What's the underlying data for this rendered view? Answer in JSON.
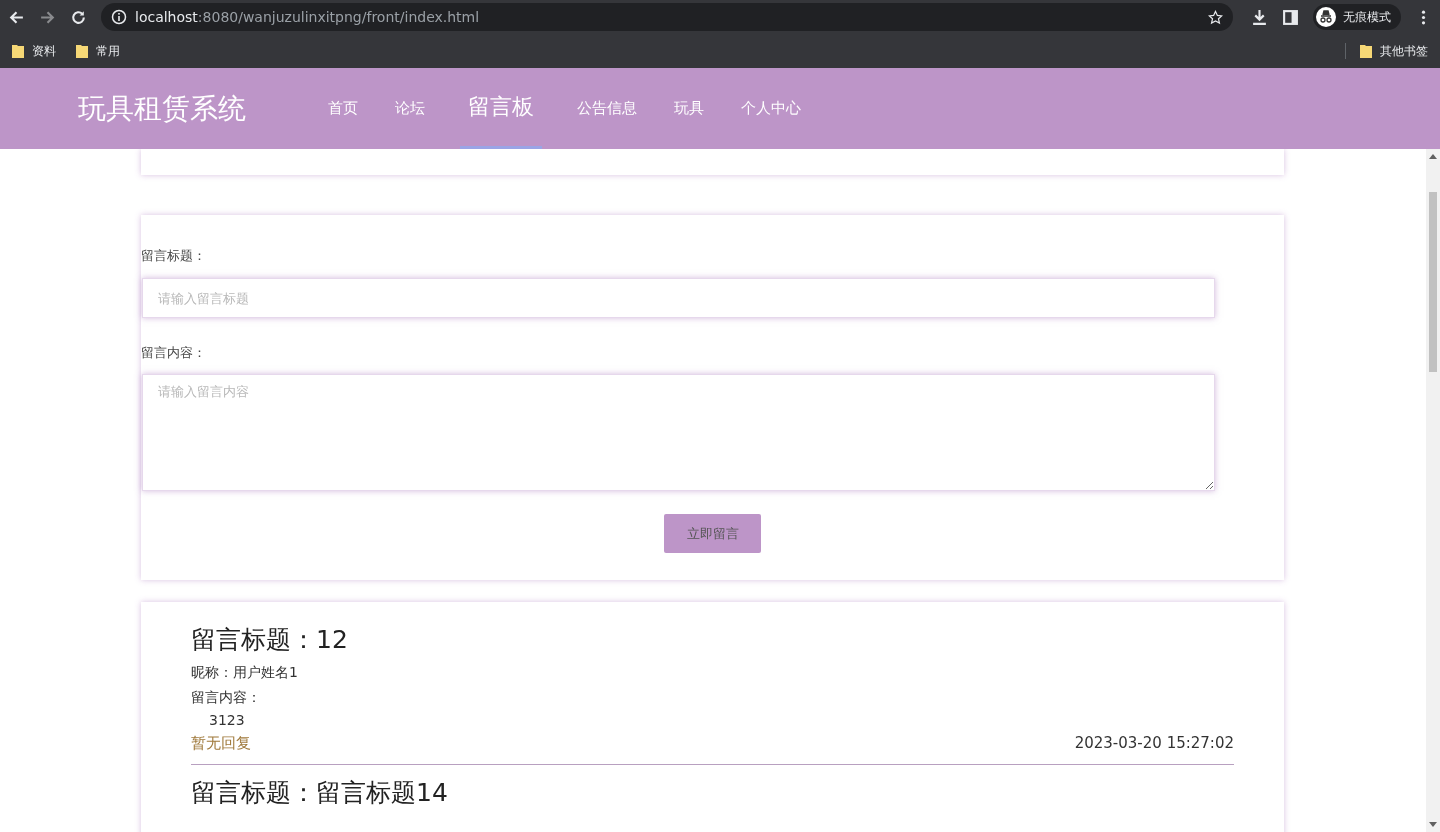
{
  "browser": {
    "url_host": "localhost",
    "url_rest": ":8080/wanjuzulinxitpng/front/index.html",
    "profile_label": "无痕模式",
    "bookmarks": [
      "资料",
      "常用"
    ],
    "other_bookmarks": "其他书签"
  },
  "header": {
    "logo": "玩具租赁系统",
    "nav": [
      {
        "label": "首页",
        "selected": false
      },
      {
        "label": "论坛",
        "selected": false
      },
      {
        "label": "留言板",
        "selected": true
      },
      {
        "label": "公告信息",
        "selected": false
      },
      {
        "label": "玩具",
        "selected": false
      },
      {
        "label": "个人中心",
        "selected": false
      }
    ]
  },
  "form": {
    "title_label": "留言标题：",
    "title_placeholder": "请输入留言标题",
    "content_label": "留言内容：",
    "content_placeholder": "请输入留言内容",
    "submit": "立即留言"
  },
  "messages": [
    {
      "title": "留言标题：12",
      "nickname": "昵称：用户姓名1",
      "content_label": "留言内容：",
      "content": "3123",
      "reply": "暂无回复",
      "time": "2023-03-20 15:27:02"
    },
    {
      "title": "留言标题：留言标题14"
    }
  ]
}
